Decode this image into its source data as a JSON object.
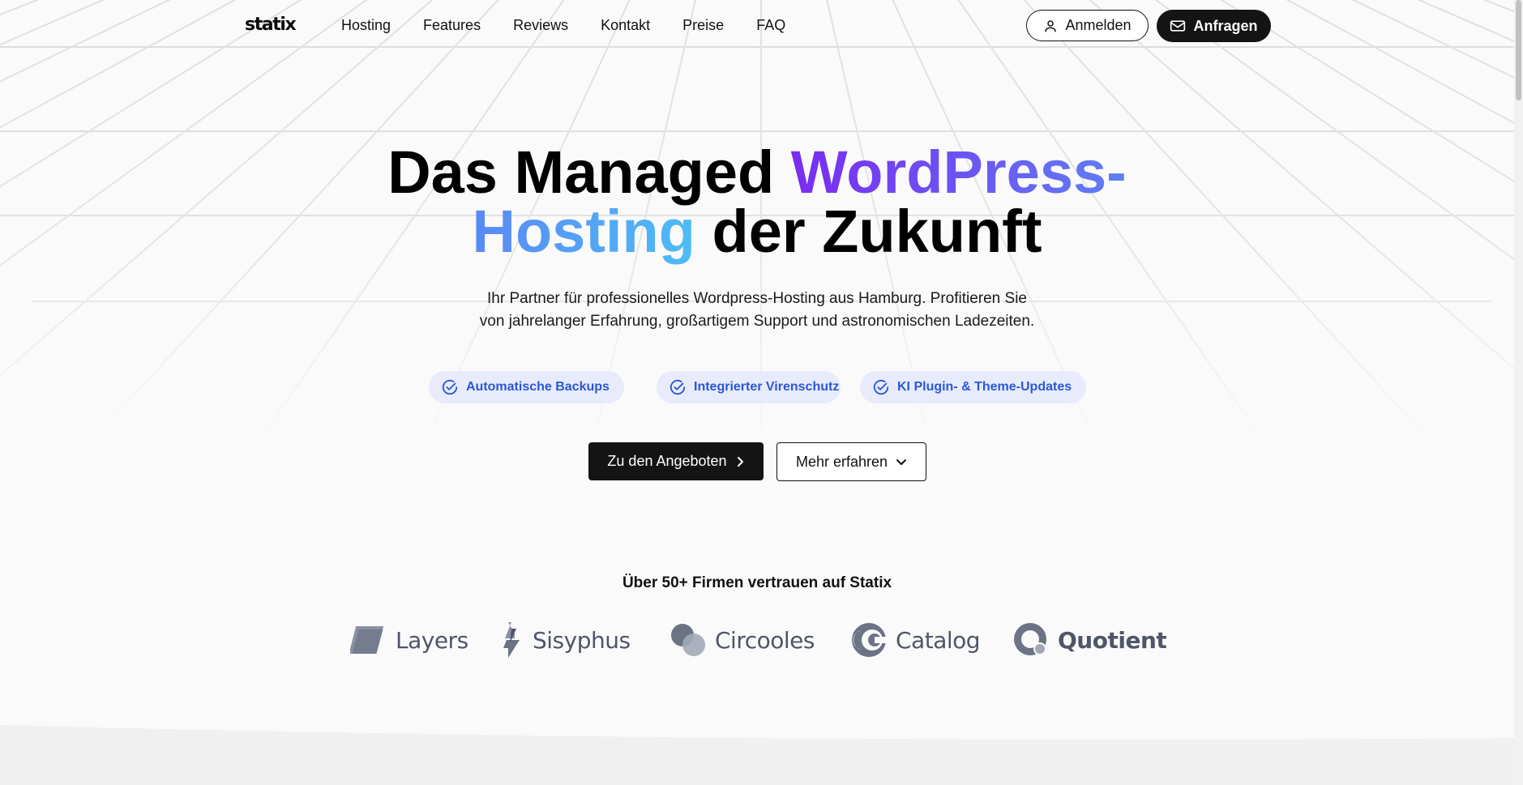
{
  "nav": {
    "logo": "statix",
    "items": [
      "Hosting",
      "Features",
      "Reviews",
      "Kontakt",
      "Preise",
      "FAQ"
    ],
    "login_label": "Anmelden",
    "request_label": "Anfragen"
  },
  "hero": {
    "title_part1": "Das Managed ",
    "title_highlight1": "WordPress-",
    "title_highlight2": "Hosting",
    "title_part2": " der Zukunft",
    "subtitle_line1": "Ihr Partner für professionelles Wordpress-Hosting aus Hamburg. Profitieren Sie",
    "subtitle_line2": "von jahrelanger Erfahrung, großartigem Support und astronomischen Ladezeiten."
  },
  "features": [
    {
      "label": "Automatische Backups",
      "icon": "check-circle-icon"
    },
    {
      "label": "Integrierter Virenschutz",
      "icon": "check-circle-icon"
    },
    {
      "label": "KI Plugin- & Theme-Updates",
      "icon": "check-circle-icon"
    }
  ],
  "cta": {
    "primary_label": "Zu den Angeboten",
    "secondary_label": "Mehr erfahren"
  },
  "trust": {
    "heading": "Über 50+ Firmen vertrauen auf Statix",
    "logos": [
      "Layers",
      "Sisyphus",
      "Circooles",
      "Catalog",
      "Quotient"
    ]
  },
  "colors": {
    "accent_purple": "#7a2cf0",
    "accent_blue": "#4dbdf6",
    "pill_bg": "#e7ebfb",
    "pill_text": "#2a58d4",
    "dark": "#141414"
  }
}
